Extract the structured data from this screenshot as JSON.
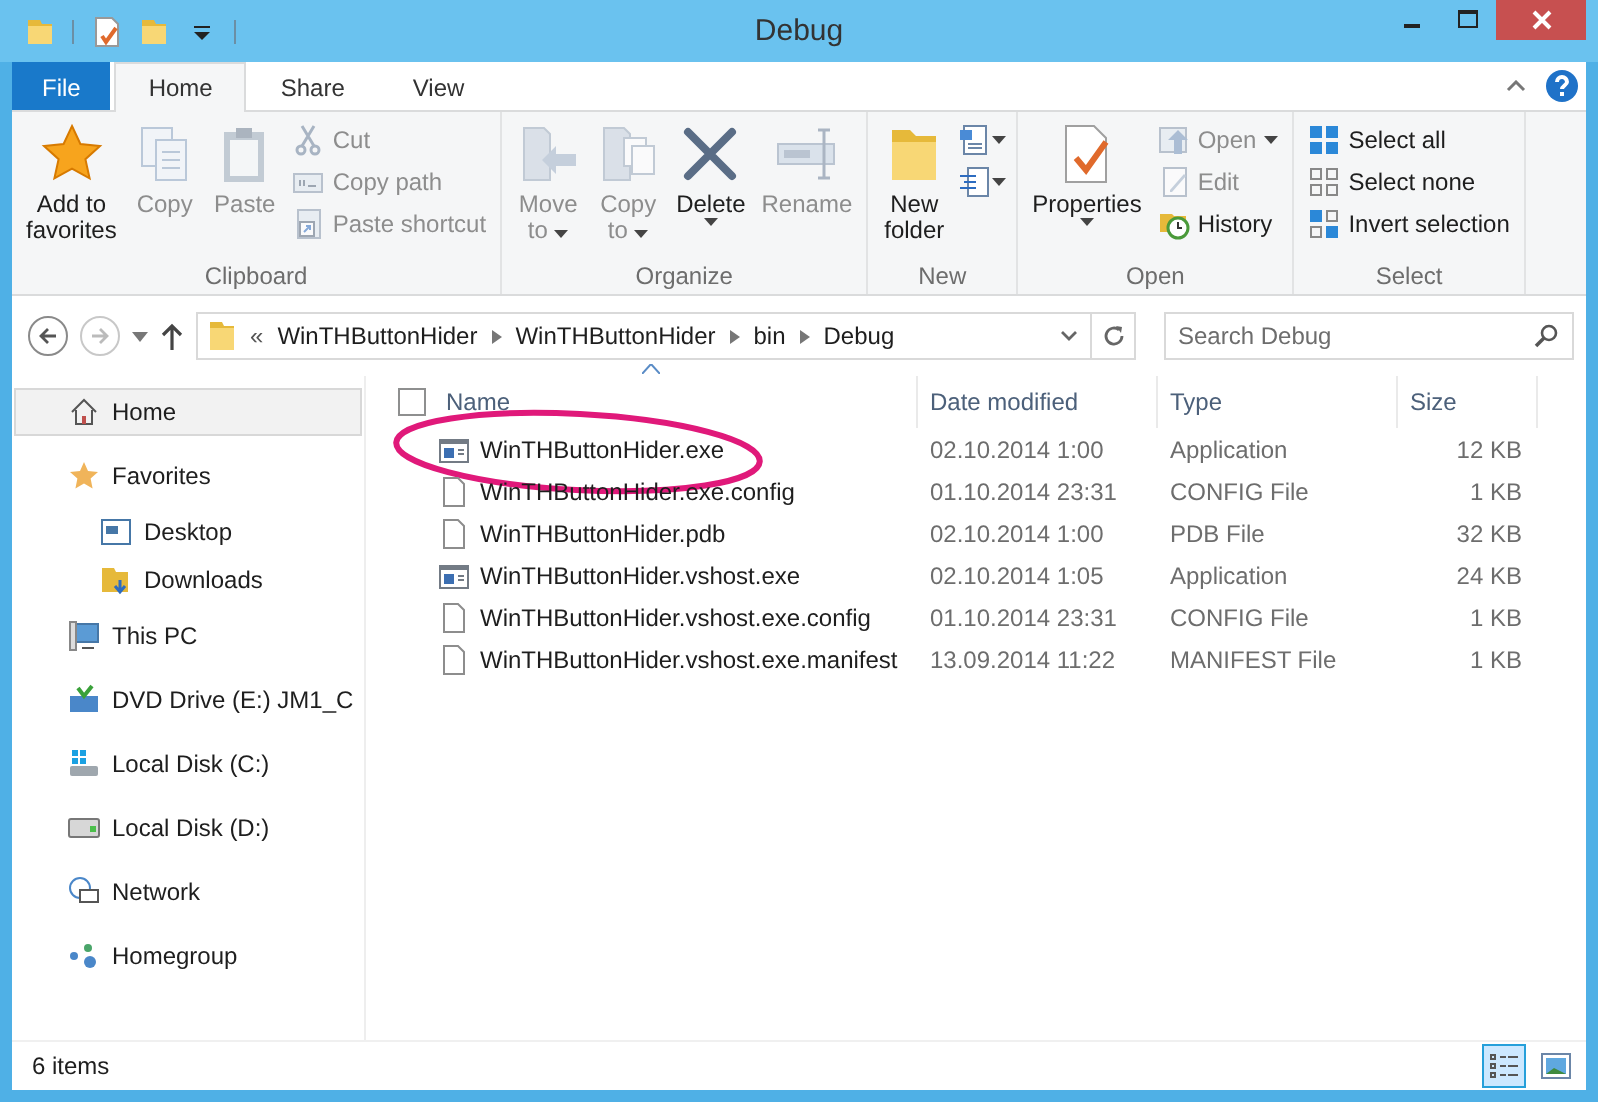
{
  "window": {
    "title": "Debug"
  },
  "ribbon_tabs": [
    {
      "label": "File",
      "kind": "file",
      "selected": false
    },
    {
      "label": "Home",
      "kind": "tab",
      "selected": true
    },
    {
      "label": "Share",
      "kind": "tab",
      "selected": false
    },
    {
      "label": "View",
      "kind": "tab",
      "selected": false
    }
  ],
  "ribbon_groups": [
    {
      "label": "Clipboard",
      "items": [
        {
          "kind": "large",
          "label": "Add to\nfavorites",
          "disabled": false
        },
        {
          "kind": "large",
          "label": "Copy",
          "disabled": true
        },
        {
          "kind": "large",
          "label": "Paste",
          "disabled": true
        },
        {
          "kind": "small",
          "label": "Cut",
          "disabled": true
        },
        {
          "kind": "small",
          "label": "Copy path",
          "disabled": true
        },
        {
          "kind": "small",
          "label": "Paste shortcut",
          "disabled": true
        }
      ]
    },
    {
      "label": "Organize",
      "items": [
        {
          "kind": "large",
          "label": "Move\nto",
          "disabled": true,
          "dropdown": true
        },
        {
          "kind": "large",
          "label": "Copy\nto",
          "disabled": true,
          "dropdown": true
        },
        {
          "kind": "large",
          "label": "Delete",
          "disabled": false,
          "dropdown": true
        },
        {
          "kind": "large",
          "label": "Rename",
          "disabled": true
        }
      ]
    },
    {
      "label": "New",
      "items": [
        {
          "kind": "large",
          "label": "New\nfolder",
          "disabled": false
        },
        {
          "kind": "icon",
          "disabled": false,
          "dropdown": true
        },
        {
          "kind": "icon",
          "disabled": false,
          "dropdown": true
        }
      ]
    },
    {
      "label": "Open",
      "items": [
        {
          "kind": "large",
          "label": "Properties",
          "disabled": false,
          "dropdown": true
        },
        {
          "kind": "small",
          "label": "Open",
          "disabled": true,
          "dropdown": true
        },
        {
          "kind": "small",
          "label": "Edit",
          "disabled": true
        },
        {
          "kind": "small",
          "label": "History",
          "disabled": false
        }
      ]
    },
    {
      "label": "Select",
      "items": [
        {
          "kind": "small",
          "label": "Select all",
          "disabled": false
        },
        {
          "kind": "small",
          "label": "Select none",
          "disabled": false
        },
        {
          "kind": "small",
          "label": "Invert selection",
          "disabled": false
        }
      ]
    }
  ],
  "address_bar": {
    "overflow_mark": "«",
    "crumbs": [
      "WinTHButtonHider",
      "WinTHButtonHider",
      "bin",
      "Debug"
    ]
  },
  "search": {
    "placeholder": "Search Debug"
  },
  "navigation": [
    {
      "label": "Home",
      "selected": true
    },
    {
      "label": "Favorites",
      "selected": false,
      "children": [
        {
          "label": "Desktop",
          "selected": false
        },
        {
          "label": "Downloads",
          "selected": false
        }
      ]
    },
    {
      "label": "This PC",
      "selected": false
    },
    {
      "label": "DVD Drive (E:) JM1_C",
      "selected": false
    },
    {
      "label": "Local Disk (C:)",
      "selected": false
    },
    {
      "label": "Local Disk (D:)",
      "selected": false
    },
    {
      "label": "Network",
      "selected": false
    },
    {
      "label": "Homegroup",
      "selected": false
    }
  ],
  "file_list": {
    "select_all": {
      "checked": false
    },
    "columns": [
      "Name",
      "Date modified",
      "Type",
      "Size"
    ],
    "rows": [
      {
        "kind": "application",
        "name": "WinTHButtonHider.exe",
        "date": "02.10.2014 1:00",
        "type": "Application",
        "size": "12 KB",
        "circled": true
      },
      {
        "kind": "file",
        "name": "WinTHButtonHider.exe.config",
        "date": "01.10.2014 23:31",
        "type": "CONFIG File",
        "size": "1 KB",
        "circled": false
      },
      {
        "kind": "file",
        "name": "WinTHButtonHider.pdb",
        "date": "02.10.2014 1:00",
        "type": "PDB File",
        "size": "32 KB",
        "circled": false
      },
      {
        "kind": "application",
        "name": "WinTHButtonHider.vshost.exe",
        "date": "02.10.2014 1:05",
        "type": "Application",
        "size": "24 KB",
        "circled": false
      },
      {
        "kind": "file",
        "name": "WinTHButtonHider.vshost.exe.config",
        "date": "01.10.2014 23:31",
        "type": "CONFIG File",
        "size": "1 KB",
        "circled": false
      },
      {
        "kind": "file",
        "name": "WinTHButtonHider.vshost.exe.manifest",
        "date": "13.09.2014 11:22",
        "type": "MANIFEST File",
        "size": "1 KB",
        "circled": false
      }
    ]
  },
  "status_bar": {
    "item_count": "6 items",
    "views": [
      {
        "kind": "details",
        "selected": true
      },
      {
        "kind": "thumbnails",
        "selected": false
      }
    ]
  }
}
